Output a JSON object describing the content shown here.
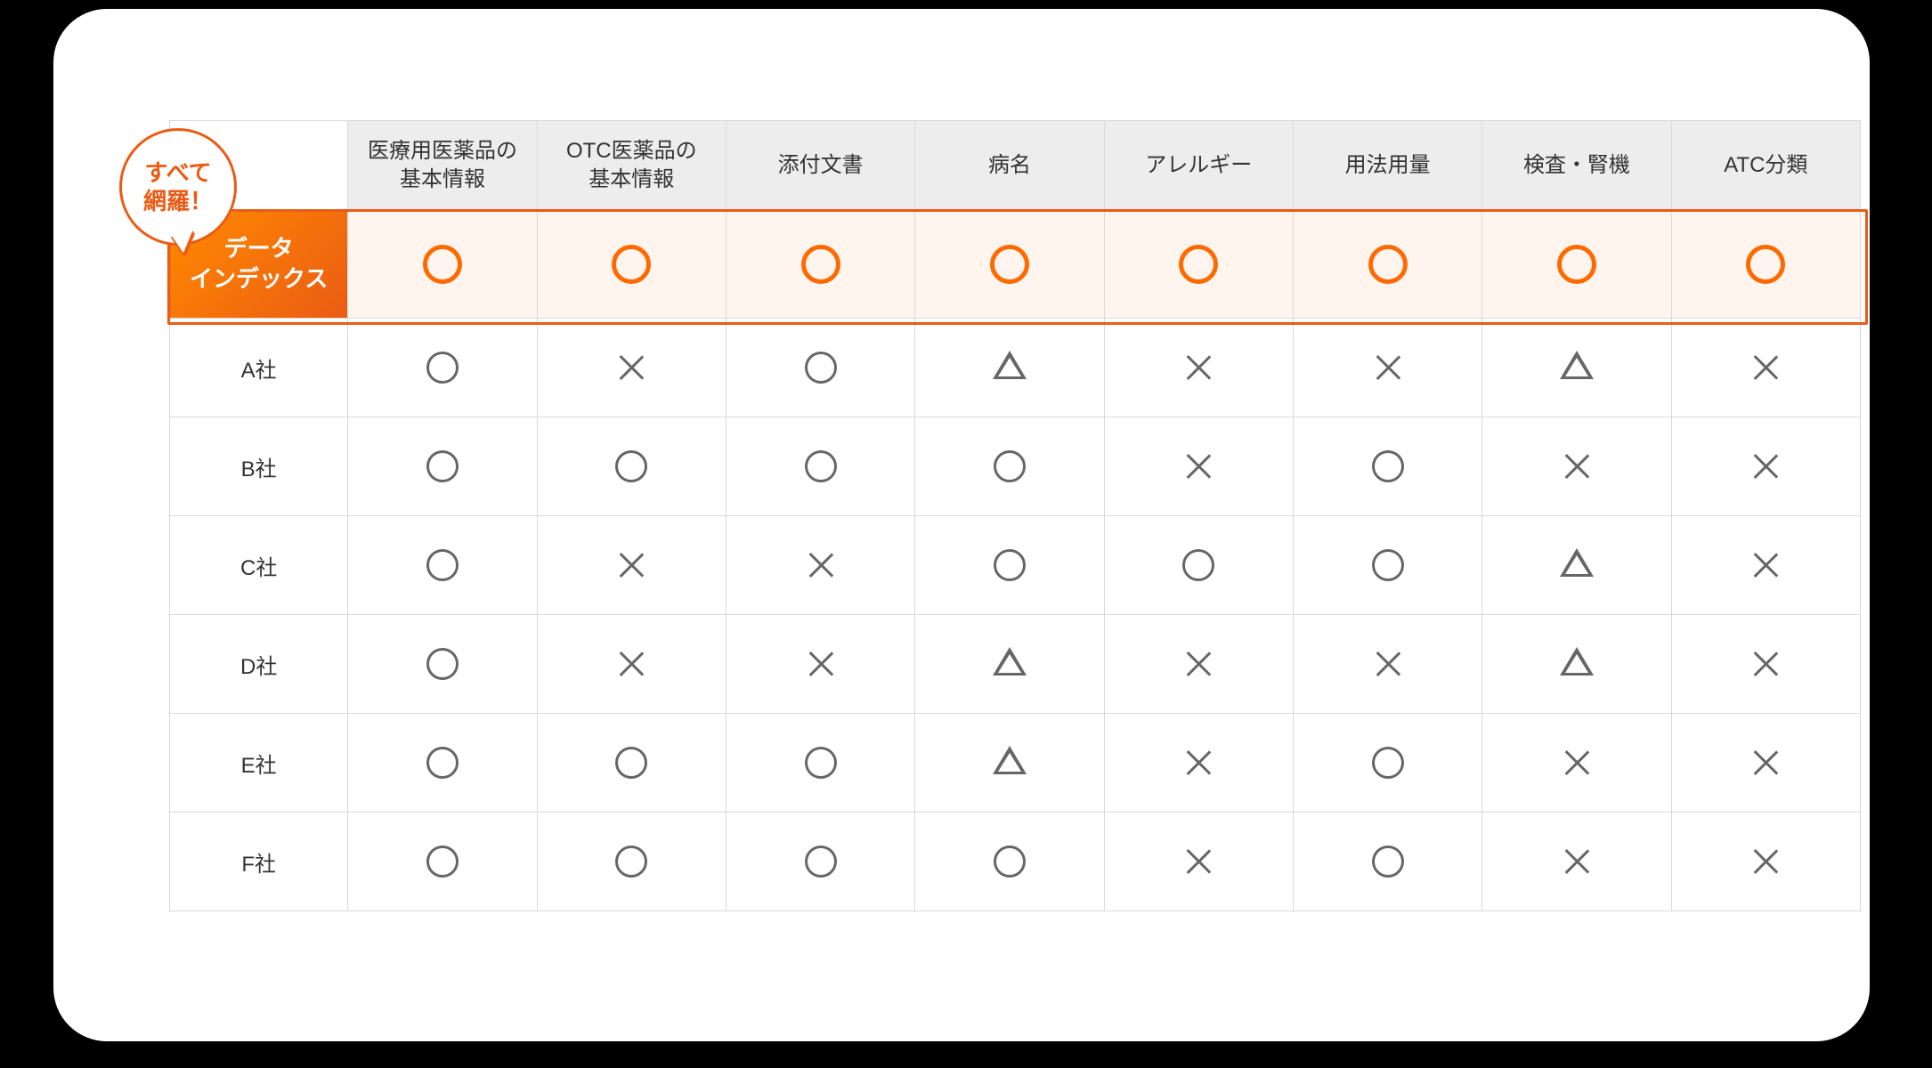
{
  "badge": "すべて\n網羅！",
  "featuredRowLabel": "データ\nインデックス",
  "columns": [
    "医療用医薬品の\n基本情報",
    "OTC医薬品の\n基本情報",
    "添付文書",
    "病名",
    "アレルギー",
    "用法用量",
    "検査・腎機",
    "ATC分類"
  ],
  "featuredRow": [
    "O",
    "O",
    "O",
    "O",
    "O",
    "O",
    "O",
    "O"
  ],
  "rows": [
    {
      "label": "A社",
      "cells": [
        "o",
        "x",
        "o",
        "t",
        "x",
        "x",
        "t",
        "x"
      ]
    },
    {
      "label": "B社",
      "cells": [
        "o",
        "o",
        "o",
        "o",
        "x",
        "o",
        "x",
        "x"
      ]
    },
    {
      "label": "C社",
      "cells": [
        "o",
        "x",
        "x",
        "o",
        "o",
        "o",
        "t",
        "x"
      ]
    },
    {
      "label": "D社",
      "cells": [
        "o",
        "x",
        "x",
        "t",
        "x",
        "x",
        "t",
        "x"
      ]
    },
    {
      "label": "E社",
      "cells": [
        "o",
        "o",
        "o",
        "t",
        "x",
        "o",
        "x",
        "x"
      ]
    },
    {
      "label": "F社",
      "cells": [
        "o",
        "o",
        "o",
        "o",
        "x",
        "o",
        "x",
        "x"
      ]
    }
  ],
  "chart_data": {
    "type": "table",
    "title": "データインデックス 網羅性比較表",
    "legend": {
      "O": "対応（強調）",
      "o": "対応",
      "t": "一部対応",
      "x": "非対応"
    },
    "columns": [
      "医療用医薬品の基本情報",
      "OTC医薬品の基本情報",
      "添付文書",
      "病名",
      "アレルギー",
      "用法用量",
      "検査・腎機",
      "ATC分類"
    ],
    "rows": [
      {
        "label": "データインデックス",
        "values": [
          "O",
          "O",
          "O",
          "O",
          "O",
          "O",
          "O",
          "O"
        ]
      },
      {
        "label": "A社",
        "values": [
          "o",
          "x",
          "o",
          "t",
          "x",
          "x",
          "t",
          "x"
        ]
      },
      {
        "label": "B社",
        "values": [
          "o",
          "o",
          "o",
          "o",
          "x",
          "o",
          "x",
          "x"
        ]
      },
      {
        "label": "C社",
        "values": [
          "o",
          "x",
          "x",
          "o",
          "o",
          "o",
          "t",
          "x"
        ]
      },
      {
        "label": "D社",
        "values": [
          "o",
          "x",
          "x",
          "t",
          "x",
          "x",
          "t",
          "x"
        ]
      },
      {
        "label": "E社",
        "values": [
          "o",
          "o",
          "o",
          "t",
          "x",
          "o",
          "x",
          "x"
        ]
      },
      {
        "label": "F社",
        "values": [
          "o",
          "o",
          "o",
          "o",
          "x",
          "o",
          "x",
          "x"
        ]
      }
    ]
  }
}
